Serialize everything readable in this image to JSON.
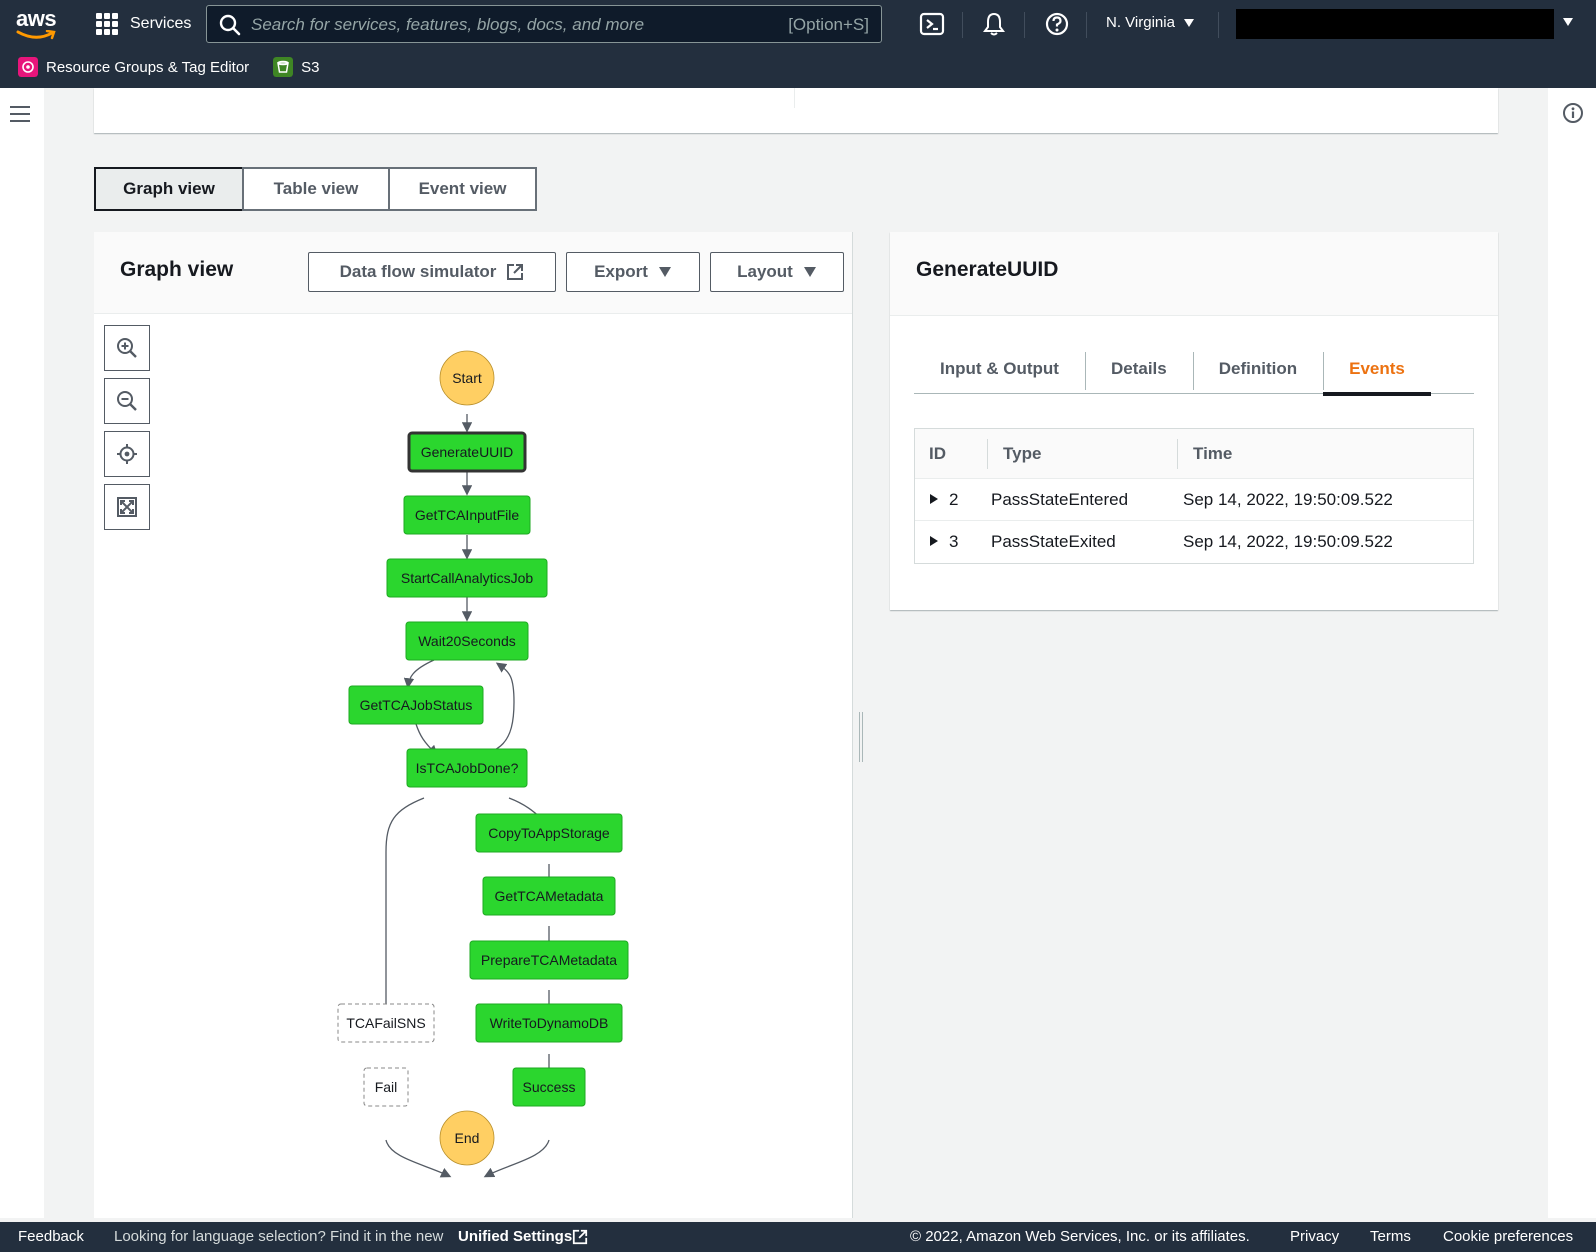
{
  "topnav": {
    "logo_text": "aws",
    "services_label": "Services",
    "search_placeholder": "Search for services, features, blogs, docs, and more",
    "search_shortcut": "[Option+S]",
    "region": "N. Virginia",
    "favorites": [
      {
        "label": "Resource Groups & Tag Editor",
        "color": "#e7157b"
      },
      {
        "label": "S3",
        "color": "#3f8624"
      }
    ]
  },
  "view_toggle": {
    "options": [
      "Graph view",
      "Table view",
      "Event view"
    ],
    "selected": "Graph view"
  },
  "graph_panel": {
    "title": "Graph view",
    "data_flow_button": "Data flow simulator",
    "export_button": "Export",
    "layout_button": "Layout",
    "zoom_controls": [
      "zoom-in-icon",
      "zoom-out-icon",
      "center-icon",
      "fit-icon"
    ]
  },
  "state_machine": {
    "start_label": "Start",
    "end_label": "End",
    "states": [
      {
        "id": "GenerateUUID",
        "status": "succeeded",
        "selected": true
      },
      {
        "id": "GetTCAInputFile",
        "status": "succeeded"
      },
      {
        "id": "StartCallAnalyticsJob",
        "status": "succeeded"
      },
      {
        "id": "Wait20Seconds",
        "status": "succeeded"
      },
      {
        "id": "GetTCAJobStatus",
        "status": "succeeded"
      },
      {
        "id": "IsTCAJobDone?",
        "status": "succeeded"
      },
      {
        "id": "CopyToAppStorage",
        "status": "succeeded"
      },
      {
        "id": "GetTCAMetadata",
        "status": "succeeded"
      },
      {
        "id": "PrepareTCAMetadata",
        "status": "succeeded"
      },
      {
        "id": "WriteToDynamoDB",
        "status": "succeeded"
      },
      {
        "id": "Success",
        "status": "succeeded"
      },
      {
        "id": "TCAFailSNS",
        "status": "not-run"
      },
      {
        "id": "Fail",
        "status": "not-run"
      }
    ],
    "colors": {
      "succeeded": "#2bd62e",
      "terminal": "#ffcf63",
      "not_run": "#ffffff"
    }
  },
  "details_panel": {
    "title": "GenerateUUID",
    "tabs": [
      "Input & Output",
      "Details",
      "Definition",
      "Events"
    ],
    "active_tab": "Events",
    "events_table": {
      "columns": [
        "ID",
        "Type",
        "Time"
      ],
      "rows": [
        {
          "id": "2",
          "type": "PassStateEntered",
          "time": "Sep 14, 2022, 19:50:09.522"
        },
        {
          "id": "3",
          "type": "PassStateExited",
          "time": "Sep 14, 2022, 19:50:09.522"
        }
      ]
    }
  },
  "footer": {
    "feedback": "Feedback",
    "language_prompt": "Looking for language selection? Find it in the new",
    "unified_settings": "Unified Settings",
    "copyright": "© 2022, Amazon Web Services, Inc. or its affiliates.",
    "privacy": "Privacy",
    "terms": "Terms",
    "cookies": "Cookie preferences"
  }
}
